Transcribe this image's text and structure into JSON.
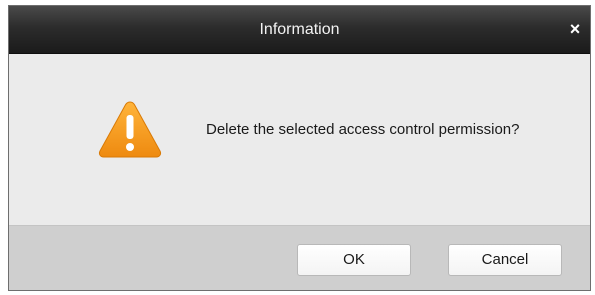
{
  "dialog": {
    "title": "Information",
    "close_icon": "close-icon",
    "close_glyph": "×",
    "warning_icon": "warning-icon",
    "message": "Delete the selected access control permission?",
    "buttons": {
      "ok_label": "OK",
      "cancel_label": "Cancel"
    }
  },
  "colors": {
    "titlebar": "#2c2c2c",
    "body": "#ebebeb",
    "footer": "#cfcfcf",
    "warning_icon": "#f5a623"
  }
}
